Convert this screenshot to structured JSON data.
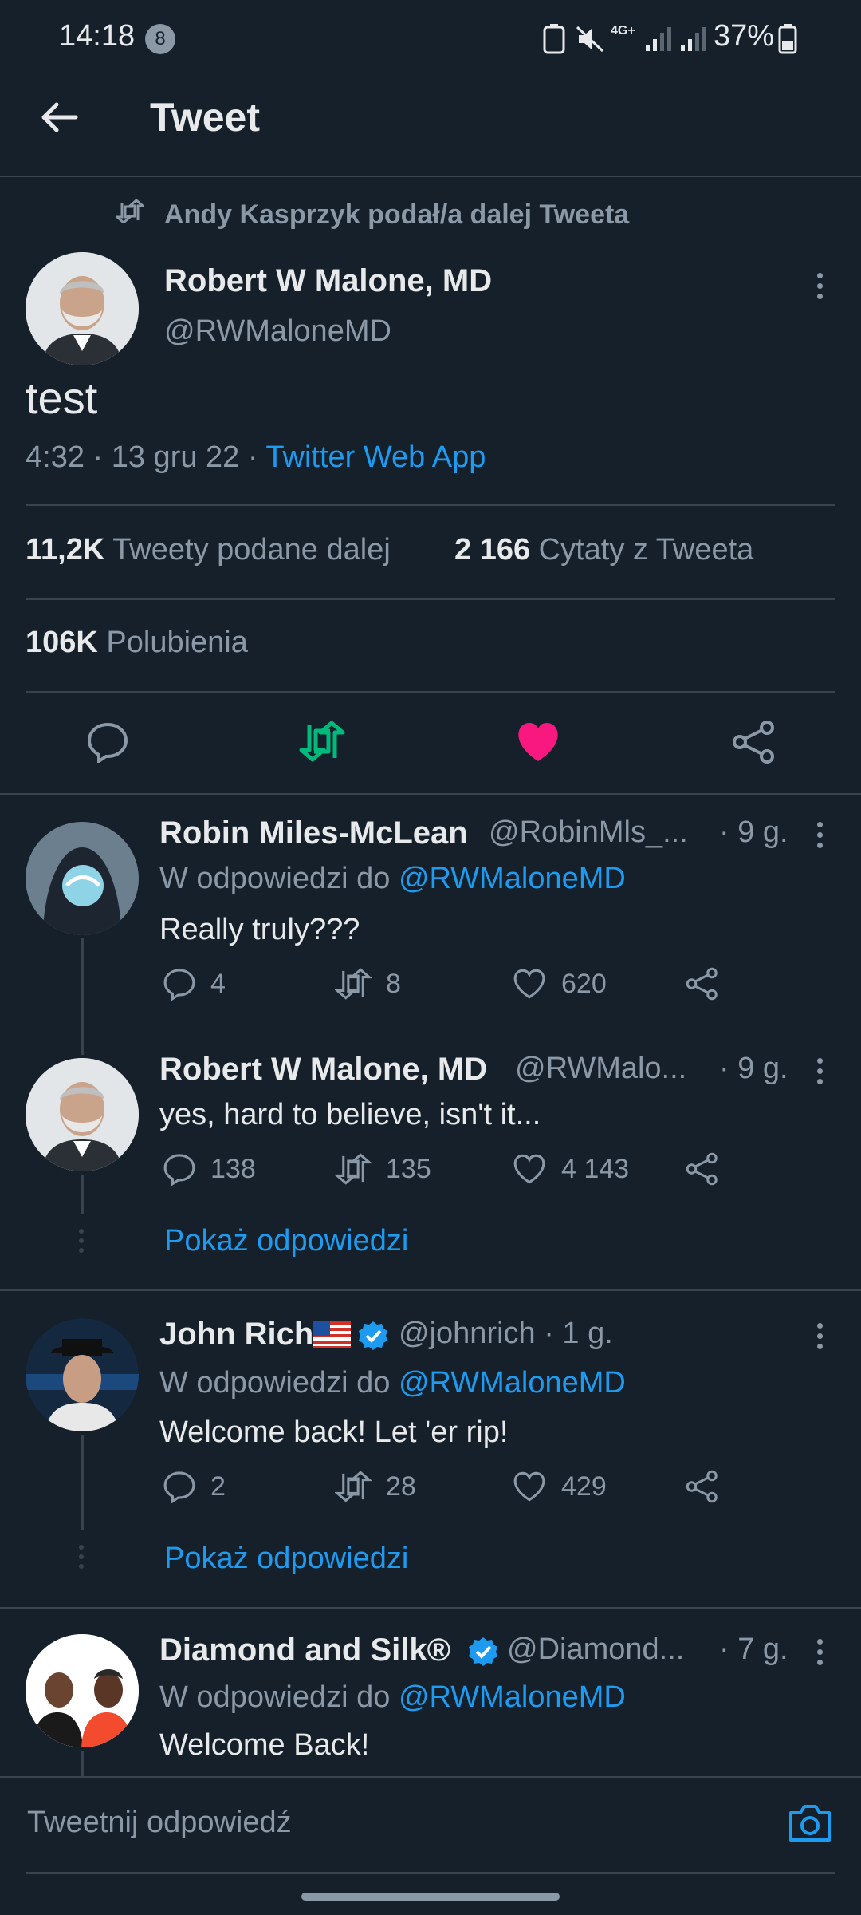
{
  "status": {
    "time": "14:18",
    "notifications": "8",
    "battery": "37%"
  },
  "header": {
    "title": "Tweet"
  },
  "main": {
    "retweet_notice": "Andy Kasprzyk podał/a dalej Tweeta",
    "author_name": "Robert W Malone, MD",
    "author_handle": "@RWMaloneMD",
    "text": "test",
    "time": "4:32 · 13 gru 22 · ",
    "source": "Twitter Web App",
    "retweets_count": "11,2K",
    "retweets_label": "Tweety podane dalej",
    "quotes_count": "2 166",
    "quotes_label": "Cytaty z Tweeta",
    "likes_count": "106K",
    "likes_label": "Polubienia"
  },
  "replies": [
    {
      "name": "Robin Miles-McLean",
      "handle": "@RobinMls_...",
      "time": "· 9 g.",
      "reply_prefix": "W odpowiedzi do ",
      "reply_to": "@RWMaloneMD",
      "text": "Really truly???",
      "comments": "4",
      "retweets": "8",
      "likes": "620"
    },
    {
      "name": "Robert W Malone, MD",
      "handle": "@RWMalo...",
      "time": "· 9 g.",
      "text": "yes, hard to believe, isn't it...",
      "comments": "138",
      "retweets": "135",
      "likes": "4 143",
      "show_replies": "Pokaż odpowiedzi"
    },
    {
      "name": "John Rich",
      "handle": "@johnrich · 1 g.",
      "reply_prefix": "W odpowiedzi do ",
      "reply_to": "@RWMaloneMD",
      "text": "Welcome back! Let 'er rip!",
      "comments": "2",
      "retweets": "28",
      "likes": "429",
      "show_replies": "Pokaż odpowiedzi"
    },
    {
      "name": "Diamond and Silk®",
      "handle": "@Diamond...",
      "time": "· 7 g.",
      "reply_prefix": "W odpowiedzi do ",
      "reply_to": "@RWMaloneMD",
      "text": "Welcome Back!"
    }
  ],
  "reply_input": {
    "placeholder": "Tweetnij odpowiedź"
  },
  "colors": {
    "background": "#15202b",
    "accent": "#1d9bf0",
    "retweet": "#00ba7c",
    "like": "#f91880"
  }
}
